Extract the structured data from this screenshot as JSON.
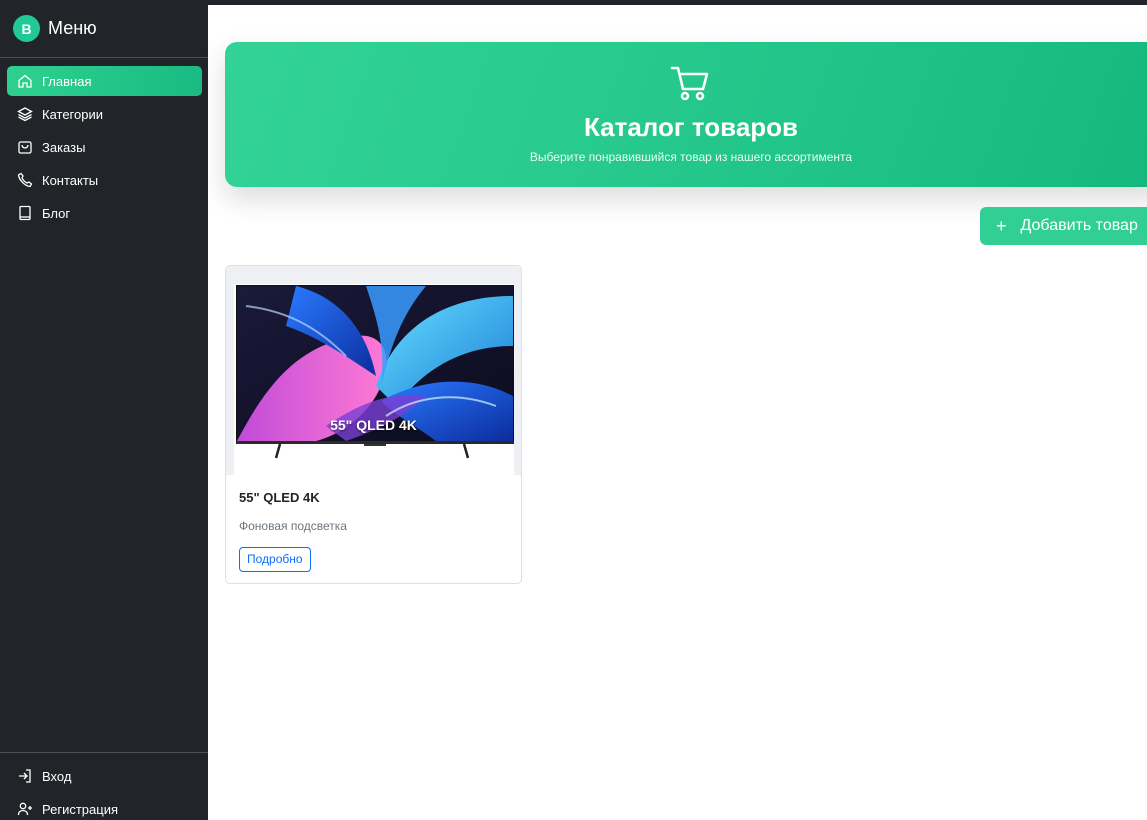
{
  "brand": {
    "badge": "B",
    "title": "Меню"
  },
  "nav": {
    "items": [
      {
        "label": "Главная",
        "icon": "home-icon",
        "active": true
      },
      {
        "label": "Категории",
        "icon": "layers-icon",
        "active": false
      },
      {
        "label": "Заказы",
        "icon": "bag-icon",
        "active": false
      },
      {
        "label": "Контакты",
        "icon": "phone-icon",
        "active": false
      },
      {
        "label": "Блог",
        "icon": "book-icon",
        "active": false
      }
    ],
    "bottom": [
      {
        "label": "Вход",
        "icon": "login-icon"
      },
      {
        "label": "Регистрация",
        "icon": "user-plus-icon"
      }
    ]
  },
  "hero": {
    "icon": "cart-icon",
    "title": "Каталог товаров",
    "subtitle": "Выберите понравившийся товар из нашего ассортимента"
  },
  "actions": {
    "add_label": "Добавить товар"
  },
  "products": [
    {
      "image_caption": "55\" QLED 4K",
      "title": "55\" QLED 4K",
      "description": "Фоновая подсветка",
      "button": "Подробно"
    }
  ],
  "colors": {
    "sidebar_bg": "#212529",
    "accent": "#20c997",
    "link": "#0d6efd"
  }
}
